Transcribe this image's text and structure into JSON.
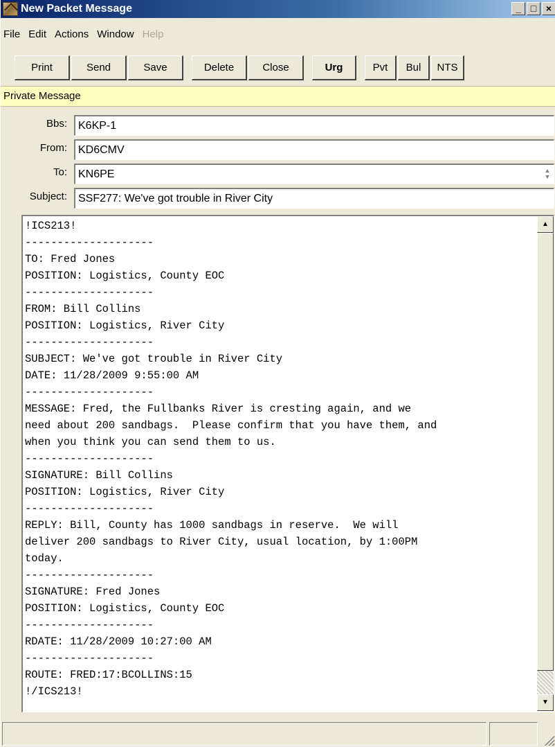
{
  "window": {
    "title": "New Packet Message",
    "controls": {
      "minimize": "_",
      "maximize": "□",
      "close": "×"
    }
  },
  "menu": [
    "File",
    "Edit",
    "Actions",
    "Window",
    "Help"
  ],
  "toolbar": {
    "print": "Print",
    "send": "Send",
    "save": "Save",
    "delete": "Delete",
    "close": "Close",
    "urg": "Urg",
    "pvt": "Pvt",
    "bul": "Bul",
    "nts": "NTS"
  },
  "info_bar": "Private Message",
  "form": {
    "bbs_label": "Bbs:",
    "bbs_value": "K6KP-1",
    "from_label": "From:",
    "from_value": "KD6CMV",
    "to_label": "To:",
    "to_value": "KN6PE",
    "subject_label": "Subject:",
    "subject_value": "SSF277: We've got trouble in River City"
  },
  "message_body": "!ICS213!\n--------------------\nTO: Fred Jones\nPOSITION: Logistics, County EOC\n--------------------\nFROM: Bill Collins\nPOSITION: Logistics, River City\n--------------------\nSUBJECT: We've got trouble in River City\nDATE: 11/28/2009 9:55:00 AM\n--------------------\nMESSAGE: Fred, the Fullbanks River is cresting again, and we\nneed about 200 sandbags.  Please confirm that you have them, and\nwhen you think you can send them to us.\n--------------------\nSIGNATURE: Bill Collins\nPOSITION: Logistics, River City\n--------------------\nREPLY: Bill, County has 1000 sandbags in reserve.  We will\ndeliver 200 sandbags to River City, usual location, by 1:00PM\ntoday.\n--------------------\nSIGNATURE: Fred Jones\nPOSITION: Logistics, County EOC\n--------------------\nRDATE: 11/28/2009 10:27:00 AM\n--------------------\nROUTE: FRED:17:BCOLLINS:15\n!/ICS213!",
  "scrollbar": {
    "up_arrow": "▲",
    "down_arrow": "▼"
  }
}
